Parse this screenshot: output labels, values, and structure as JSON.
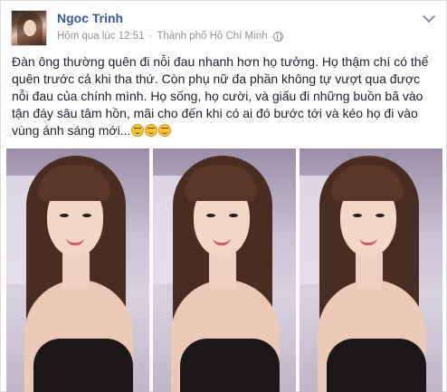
{
  "post": {
    "author_name": "Ngoc Trinh",
    "timestamp": "Hôm qua lúc 12:51",
    "separator": "·",
    "location": "Thành phố Hồ Chí Minh",
    "privacy_icon": "globe-icon",
    "options_icon": "chevron-down-icon",
    "text": "Đàn ông thường quên đi nỗi đau nhanh hơn họ tưởng. Họ thậm chí có thể quên trước cả khi tha thứ. Còn phụ nữ đa phần không tự vượt qua được nỗi đau của chính mình. Họ sống, họ cười, và giấu đi những buồn bã vào tận đáy sâu tâm hồn, mãi cho đến khi có ai đó bước tới và kéo họ đi vào vùng ánh sáng mới...",
    "emoji": [
      "smiling-face-icon",
      "smiling-face-icon",
      "smiling-face-icon"
    ],
    "photos_count": 3
  },
  "colors": {
    "name": "#365899",
    "meta": "#90949c",
    "text": "#1d2129",
    "border": "#dddfe2"
  }
}
